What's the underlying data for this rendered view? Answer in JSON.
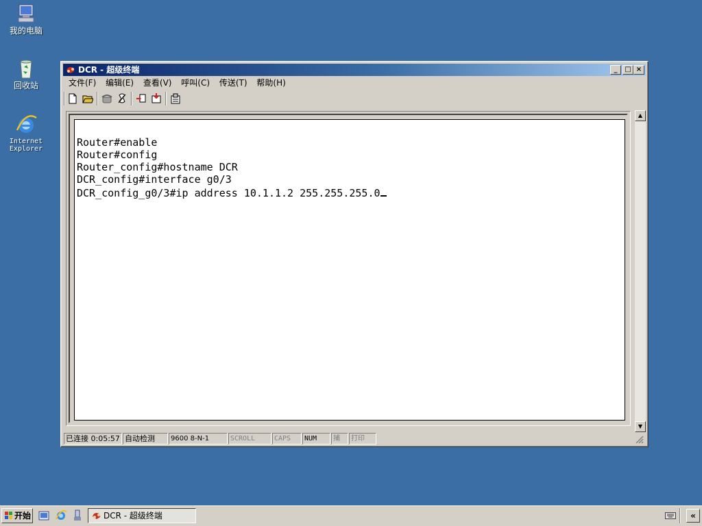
{
  "desktop": {
    "icons": [
      {
        "label": "我的电脑",
        "icon": "my-computer-icon"
      },
      {
        "label": "回收站",
        "icon": "recycle-bin-icon"
      },
      {
        "label_line1": "Internet",
        "label_line2": "Explorer",
        "icon": "internet-explorer-icon"
      }
    ],
    "background_color": "#3a6ea5"
  },
  "window": {
    "title": "DCR - 超级终端",
    "menu": [
      "文件(F)",
      "编辑(E)",
      "查看(V)",
      "呼叫(C)",
      "传送(T)",
      "帮助(H)"
    ],
    "controls": {
      "minimize": "_",
      "maximize": "□",
      "close": "×"
    },
    "toolbar": [
      "new-icon",
      "open-icon",
      "phone-icon",
      "disconnect-icon",
      "send-icon",
      "receive-icon",
      "properties-icon"
    ]
  },
  "terminal": {
    "lines": [
      "Router#enable",
      "Router#config",
      "Router_config#hostname DCR",
      "DCR_config#interface g0/3",
      "DCR_config_g0/3#ip address 10.1.1.2 255.255.255.0"
    ]
  },
  "statusbar": {
    "connected": "已连接 0:05:57",
    "detect": "自动检测",
    "baud": "9600 8-N-1",
    "scroll": "SCROLL",
    "caps": "CAPS",
    "num": "NUM",
    "capture": "捕",
    "print": "打印"
  },
  "taskbar": {
    "start": "开始",
    "quick_launch": [
      "show-desktop-icon",
      "internet-explorer-icon",
      "explorer-icon"
    ],
    "task": "DCR - 超级终端",
    "tray_arrow": "«"
  }
}
